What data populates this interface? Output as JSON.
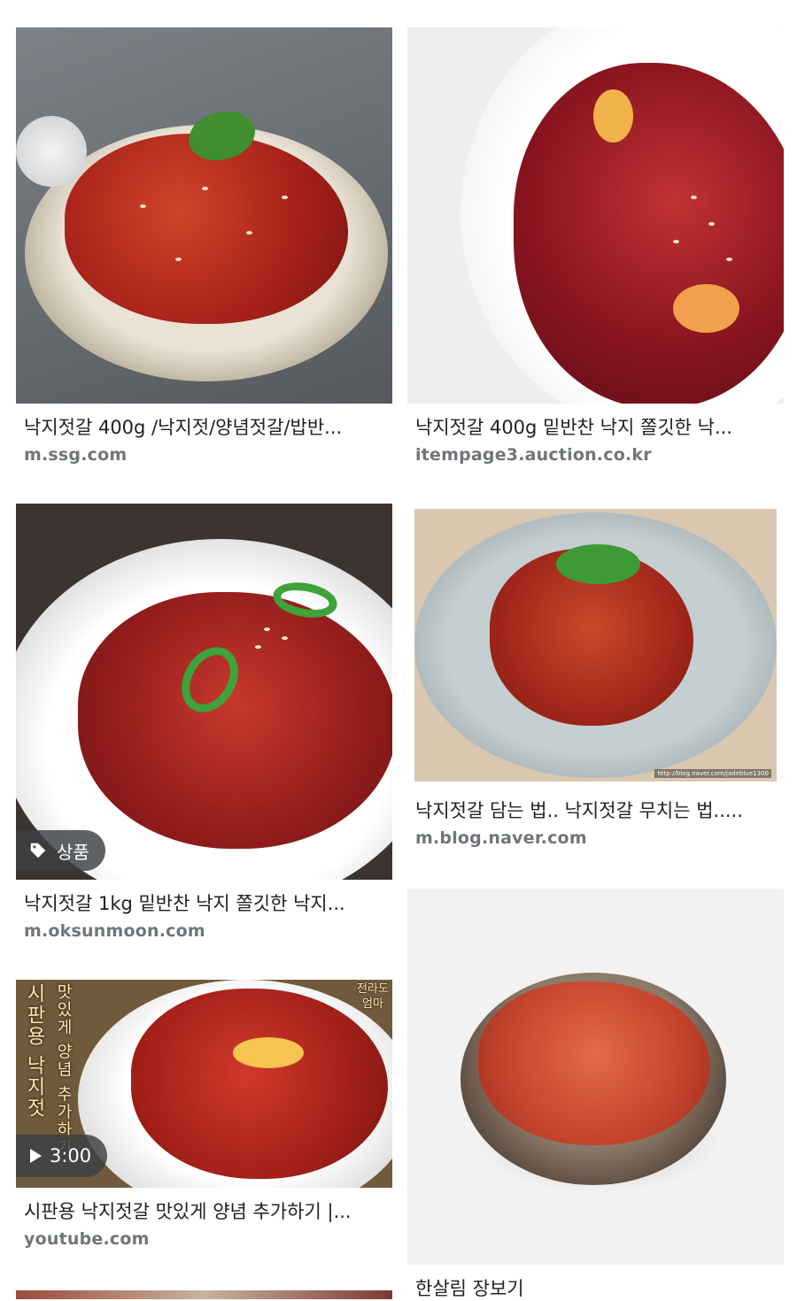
{
  "results": [
    {
      "title": "낙지젓갈 400g /낙지젓/양념젓갈/밥반...",
      "source": "m.ssg.com",
      "image": "octopus-jeotgal-in-ceramic-bowl"
    },
    {
      "title": "낙지젓갈 400g 밑반찬 낙지 쫄깃한 낙...",
      "source": "itempage3.auction.co.kr",
      "image": "octopus-jeotgal-closeup"
    },
    {
      "title": "낙지젓갈 1kg 밑반찬 낙지 쫄깃한 낙지...",
      "source": "m.oksunmoon.com",
      "badge": "상품",
      "image": "octopus-jeotgal-with-green-pepper"
    },
    {
      "title": "낙지젓갈 담는 법.. 낙지젓갈 무치는 법.....",
      "source": "m.blog.naver.com",
      "image": "octopus-jeotgal-on-gray-plate",
      "watermark": "http://blog.naver.com/jadeblue1300"
    },
    {
      "title": "시판용 낙지젓갈 맛있게 양념 추가하기 |...",
      "source": "youtube.com",
      "video_duration": "3:00",
      "image": "octopus-jeotgal-video-thumbnail",
      "overlay_text": {
        "col1": "시판용 낙지젓",
        "col2": "맛있게 양념 추가하기",
        "corner": "전라도 엄마"
      }
    },
    {
      "title": "한살림 장보기",
      "source": "",
      "image": "octopus-jeotgal-in-dark-bowl"
    }
  ],
  "icons": {
    "badge": "tag-icon",
    "video": "play-icon"
  }
}
